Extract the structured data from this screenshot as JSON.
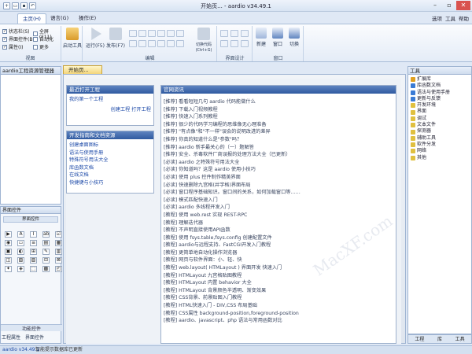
{
  "window": {
    "title": "开始页... - aardio v34.49.1"
  },
  "menu": {
    "tabs": [
      "主页(H)",
      "语言(G)",
      "操作(E)"
    ],
    "active": 0,
    "right": [
      "选项",
      "工具",
      "帮助"
    ]
  },
  "ribbon": {
    "view_checks": [
      {
        "label": "状态栏(S)",
        "checked": true
      },
      {
        "label": "界面控件(B)",
        "checked": true
      },
      {
        "label": "属性(I)",
        "checked": true
      },
      {
        "label": "全屏(F11)",
        "checked": false
      },
      {
        "label": "自动化",
        "checked": false
      },
      {
        "label": "更多",
        "checked": false
      }
    ],
    "view_label": "视图",
    "tools": {
      "launch": "启动工具",
      "run": "运行(F5)",
      "publish": "发布(F7)",
      "replace": "切换代码\n(Ctrl+G)"
    },
    "edit_label": "编辑",
    "design_label": "界面设计",
    "window_btns": [
      "新建",
      "窗口",
      "切换"
    ],
    "window_label": "窗口"
  },
  "left_panel": {
    "title": "aardio工程资源管理器",
    "props_title": "界面控件",
    "props_sub": "界面控件",
    "props_footer": "功能控件",
    "tabs": [
      "工程属性",
      "界面控件"
    ],
    "toolbox": [
      "▶",
      "A",
      "I",
      "ab",
      "☑",
      "◉",
      "▭",
      "≡",
      "▤",
      "▦",
      "▣",
      "◐",
      "⊞",
      "✎",
      "▥",
      "◫",
      "▧",
      "▨",
      "⊟",
      "⊠",
      "✦",
      "◈",
      "⬚",
      "▩",
      "◰"
    ]
  },
  "doc": {
    "tab": "开始页..."
  },
  "start": {
    "recent_title": "最近打开工程",
    "recent_item": "我的第一个工程",
    "create_link": "创建工程",
    "open_link": "打开工程",
    "help_title": "开发指南和文档资源",
    "help_items": [
      "创建桌面图标",
      "语法与使用手册",
      "特殊符号用法大全",
      "库函数文档",
      "在线文档",
      "快捷键与小技巧"
    ],
    "news_title": "官网资讯",
    "news": [
      "[推荐] 看看短短几句 aardio 代码能做什么",
      "[推荐] 下载入门视频教程",
      "[推荐] 快速入门系列教程",
      "[推荐] 很少的代码学习编程的思维像无心理准备",
      "[推荐] \"有点像\"和\"不一样\"误会的说明改进的差异",
      "[推荐] 你真的知道什么是\"参数\"吗？",
      "[推荐] aardio 新手最关心的（一）题解答",
      "[推荐] 安全、杀毒软件厂商误报的处理方法大全（已更新）",
      "[必读] aardio 之特殊符号用法大全",
      "[必读] 你知道吗？这是 aardio 使用小技巧",
      "[必读] 使用 plus 控件制作精美界面",
      "[必读] 快速删除九宫格(井字格)界面布局",
      "[必读] 窗口程序基础知识。窗口间的关系，如何加载窗口等……",
      "[必读] 模式匹配快速入门",
      "[必读] aardio 多线程开发入门",
      "[教程] 使用 web.rest 实现 REST-RPC",
      "[教程] 理解迭代器",
      "[教程] 不声明直接使用API函数",
      "[教程] 使用 fsys.table,fsys.config 创建配置文件",
      "[教程] aardio与远程支持、FastCGI开发入门教程",
      "[教程] 更简单地自动化操作浏览器",
      "[教程] 网页与软件界面：小、轻、快",
      "[教程] web.layout( HTMLayout ) 界面开发 快速入门",
      "[教程] HTMLayout 九宫格贴图教程",
      "[教程] HTMLayout 内置 behavior 大全",
      "[教程] HTMLayout 背景颜色半透明、渐变效果",
      "[教程] CSS背景、前景贴图入门教程",
      "[教程] HTML快速入门 - DIV,CSS 布局基础",
      "[教程] CSS属性 background-position,foreground-position",
      "[教程] aardio、javascript、php 语法与常用函数对比"
    ]
  },
  "right_panel": {
    "title": "工具",
    "items": [
      {
        "label": "扩展库",
        "color": "#e0a020"
      },
      {
        "label": "库函数文档",
        "color": "#3a7bd5"
      },
      {
        "label": "语法与使用手册",
        "color": "#3a7bd5"
      },
      {
        "label": "更新与反馈",
        "color": "#3a7bd5"
      },
      {
        "label": "开发环境",
        "color": "#e0c040"
      },
      {
        "label": "界面",
        "color": "#e0c040"
      },
      {
        "label": "调试",
        "color": "#e0c040"
      },
      {
        "label": "文本文件",
        "color": "#e0c040"
      },
      {
        "label": "探测器",
        "color": "#e0c040"
      },
      {
        "label": "辅助工具",
        "color": "#e0c040"
      },
      {
        "label": "软件分发",
        "color": "#e0c040"
      },
      {
        "label": "网络",
        "color": "#e0c040"
      },
      {
        "label": "其他",
        "color": "#e0c040"
      }
    ],
    "tabs": [
      "工程",
      "库",
      "工具"
    ]
  },
  "status": {
    "version": "aardio v34.49.1",
    "message": "智能提示数据库已更新"
  },
  "watermark": "MacXF.com"
}
